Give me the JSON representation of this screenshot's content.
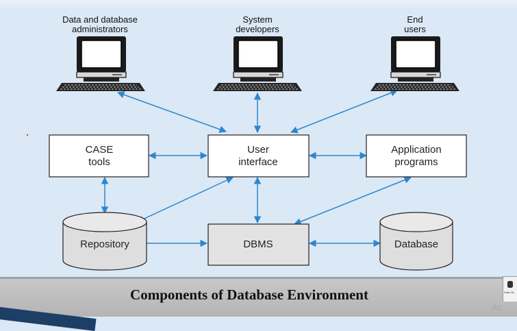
{
  "diagram": {
    "users": [
      {
        "id": "admins",
        "label_line1": "Data and database",
        "label_line2": "administrators"
      },
      {
        "id": "developers",
        "label_line1": "System",
        "label_line2": "developers"
      },
      {
        "id": "endusers",
        "label_line1": "End",
        "label_line2": "users"
      }
    ],
    "boxes": {
      "case_line1": "CASE",
      "case_line2": "tools",
      "ui_line1": "User",
      "ui_line2": "interface",
      "apps_line1": "Application",
      "apps_line2": "programs",
      "dbms": "DBMS"
    },
    "cylinders": {
      "repository": "Repository",
      "database": "Database"
    },
    "caption": "Components of Database Environment"
  },
  "chrome": {
    "corner_tile_text": "Data Vis",
    "ghost_text": "Ac"
  },
  "colors": {
    "arrow": "#2d86cd",
    "box_fill": "#ffffff",
    "dbms_fill": "#e3e3e3",
    "cylinder_fill": "#dedede",
    "background": "#dbe8f5"
  }
}
